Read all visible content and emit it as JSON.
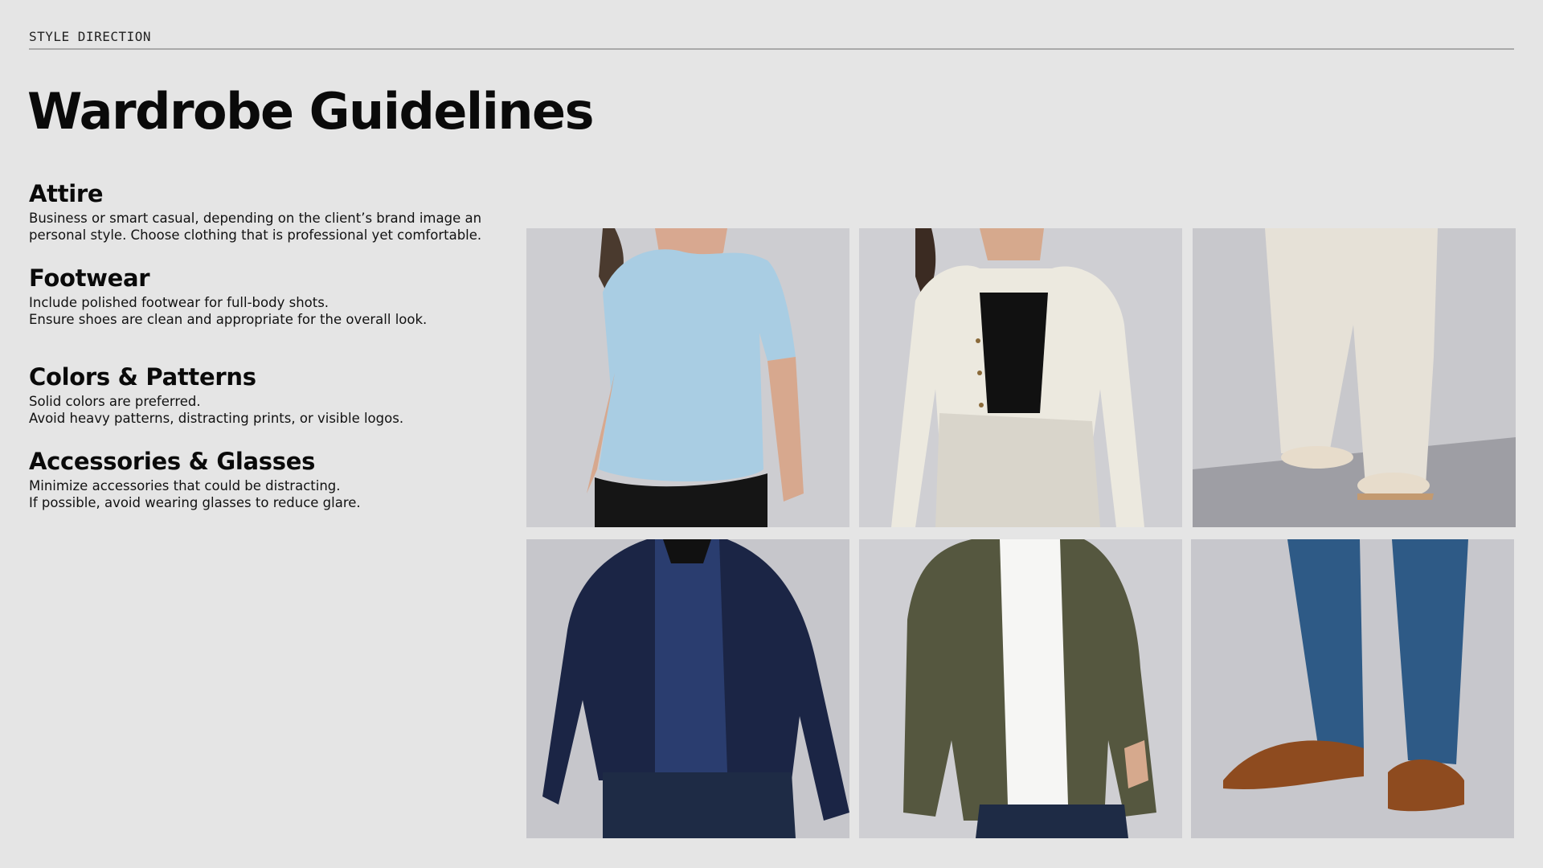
{
  "header": {
    "eyebrow": "STYLE DIRECTION"
  },
  "title": "Wardrobe Guidelines",
  "sections": [
    {
      "heading": "Attire",
      "lines": [
        "Business or smart casual, depending on the client’s brand image an",
        "personal style. Choose clothing that is professional yet comfortable."
      ]
    },
    {
      "heading": "Footwear",
      "lines": [
        "Include polished footwear for full-body shots.",
        "Ensure shoes are clean and appropriate for the overall look."
      ]
    },
    {
      "heading": "Colors & Patterns",
      "lines": [
        "Solid colors are preferred.",
        "Avoid heavy patterns, distracting prints, or visible logos."
      ]
    },
    {
      "heading": "Accessories & Glasses",
      "lines": [
        "Minimize accessories that could be distracting.",
        "If possible, avoid wearing glasses to reduce glare."
      ]
    }
  ],
  "photos": [
    {
      "subject": "light-blue-cowl-neck-tee",
      "color": "#a9cde3"
    },
    {
      "subject": "cream-cropped-cardigan",
      "color": "#ece9df"
    },
    {
      "subject": "cream-wide-leg-trousers-sneakers",
      "color": "#e6e1d7"
    },
    {
      "subject": "navy-blazer-denim-shirt",
      "color": "#1b2545"
    },
    {
      "subject": "olive-overshirt-white-tee",
      "color": "#55573f"
    },
    {
      "subject": "blue-jeans-brown-oxfords",
      "color": "#2e5a86"
    }
  ]
}
